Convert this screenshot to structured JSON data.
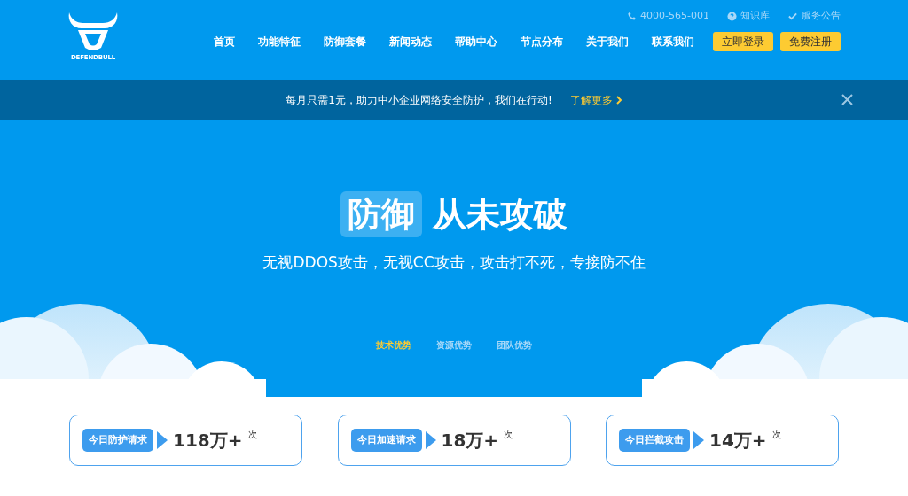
{
  "logo": {
    "text": "DEFENDBULL"
  },
  "top_links": [
    {
      "kind": "phone",
      "label": "4000-565-001"
    },
    {
      "kind": "help",
      "label": "知识库"
    },
    {
      "kind": "check",
      "label": "服务公告"
    }
  ],
  "nav": [
    "首页",
    "功能特征",
    "防御套餐",
    "新闻动态",
    "帮助中心",
    "节点分布",
    "关于我们",
    "联系我们"
  ],
  "buttons": [
    "立即登录",
    "免费注册"
  ],
  "notice": {
    "text": "每月只需1元，助力中小企业网络安全防护，我们在行动!",
    "link": "了解更多"
  },
  "hero": {
    "highlight": "防御",
    "title": "从未攻破",
    "subtitle": "无视DDOS攻击，无视CC攻击，攻击打不死，专接防不住"
  },
  "tabs": [
    {
      "label": "技术优势",
      "selected": true
    },
    {
      "label": "资源优势",
      "selected": false
    },
    {
      "label": "团队优势",
      "selected": false
    }
  ],
  "stats": [
    {
      "label": "今日防护请求",
      "value": "118万+",
      "unit": "次"
    },
    {
      "label": "今日加速请求",
      "value": "18万+",
      "unit": "次"
    },
    {
      "label": "今日拦截攻击",
      "value": "14万+",
      "unit": "次"
    }
  ]
}
